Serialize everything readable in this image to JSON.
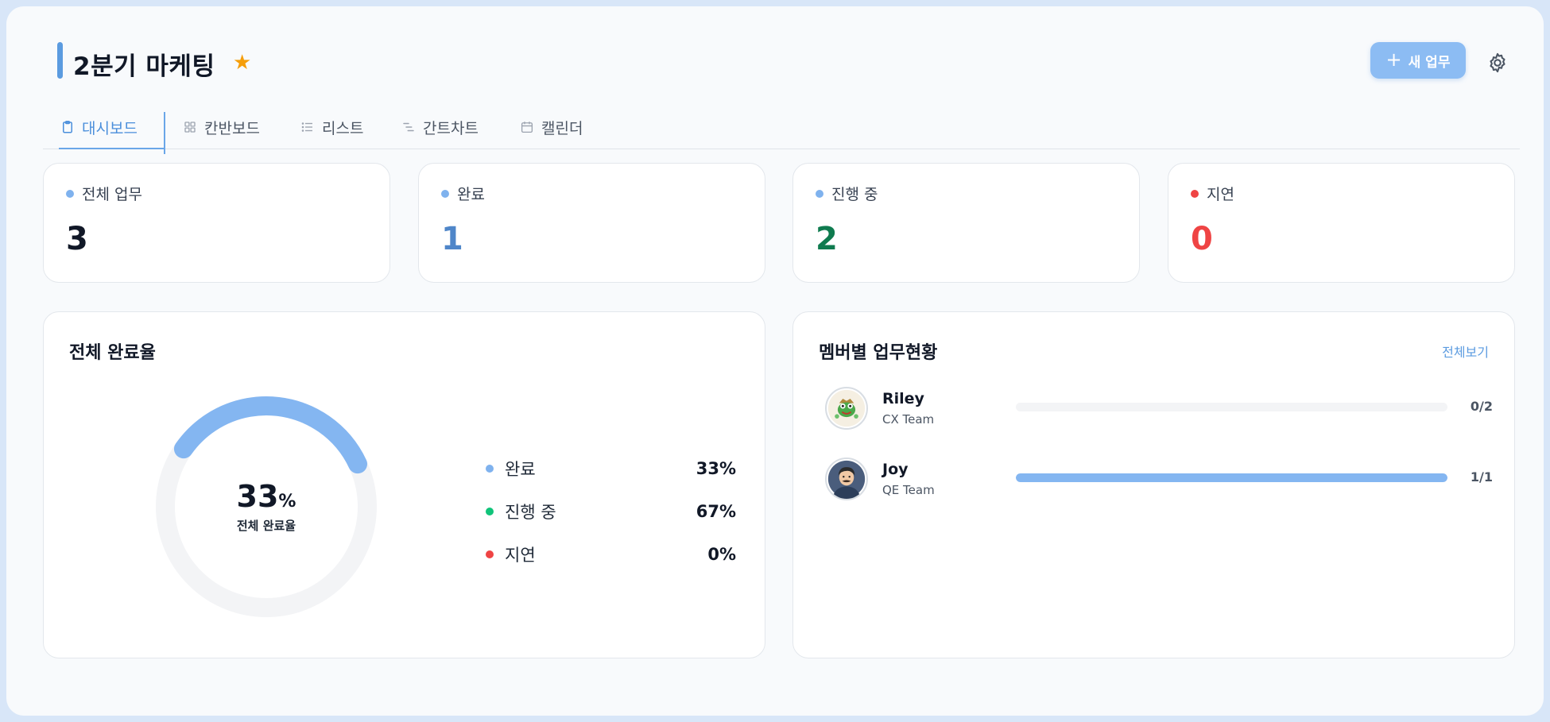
{
  "header": {
    "title": "2분기 마케팅",
    "new_task_label": "새 업무"
  },
  "tabs": [
    {
      "label": "대시보드",
      "icon": "clipboard-icon",
      "active": true
    },
    {
      "label": "칸반보드",
      "icon": "grid-icon",
      "active": false
    },
    {
      "label": "리스트",
      "icon": "list-icon",
      "active": false
    },
    {
      "label": "간트차트",
      "icon": "gantt-icon",
      "active": false
    },
    {
      "label": "캘린더",
      "icon": "calendar-icon",
      "active": false
    }
  ],
  "stats": [
    {
      "label": "전체 업무",
      "value": "3",
      "dot_color": "#7fb2ee",
      "value_color": "#111827"
    },
    {
      "label": "완료",
      "value": "1",
      "dot_color": "#7fb2ee",
      "value_color": "#4f86c9"
    },
    {
      "label": "진행 중",
      "value": "2",
      "dot_color": "#7fb2ee",
      "value_color": "#0f7b4f"
    },
    {
      "label": "지연",
      "value": "0",
      "dot_color": "#ef4444",
      "value_color": "#ef4444"
    }
  ],
  "completion": {
    "title": "전체 완료율",
    "percent_value": "33",
    "percent_sign": "%",
    "center_label": "전체 완료율",
    "fraction": 0.333,
    "legend": [
      {
        "label": "완료",
        "value": "33%",
        "color": "#7fb2ee"
      },
      {
        "label": "진행 중",
        "value": "67%",
        "color": "#10c47a"
      },
      {
        "label": "지연",
        "value": "0%",
        "color": "#ef4444"
      }
    ]
  },
  "members": {
    "title": "멤버별 업무현황",
    "view_all": "전체보기",
    "items": [
      {
        "name": "Riley",
        "team": "CX Team",
        "count": "0/2",
        "progress": 0.0
      },
      {
        "name": "Joy",
        "team": "QE Team",
        "count": "1/1",
        "progress": 1.0
      }
    ]
  },
  "colors": {
    "accent": "#5b9be0",
    "star": "#f59e0b",
    "track": "#f3f4f6"
  }
}
